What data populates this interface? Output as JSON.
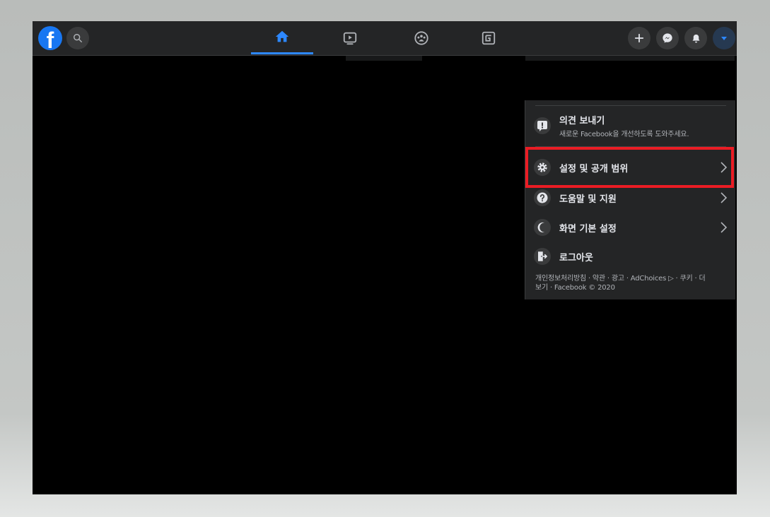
{
  "header": {
    "logo": "f",
    "search_icon": "search-icon",
    "nav_tabs": [
      {
        "icon": "home-icon",
        "active": true
      },
      {
        "icon": "watch-icon",
        "active": false
      },
      {
        "icon": "groups-icon",
        "active": false
      },
      {
        "icon": "gaming-icon",
        "active": false
      }
    ],
    "right_buttons": [
      "plus-icon",
      "messenger-icon",
      "bell-icon",
      "caret-down-icon"
    ],
    "colors": {
      "accent": "#2d88ff",
      "brand": "#1877f2",
      "bar": "#242526"
    }
  },
  "menu": {
    "feedback": {
      "label": "의견 보내기",
      "subtitle": "새로운 Facebook을 개선하도록 도와주세요.",
      "icon": "exclamation-icon"
    },
    "items": [
      {
        "label": "설정 및 공개 범위",
        "icon": "gear-icon",
        "has_arrow": true,
        "highlighted": true
      },
      {
        "label": "도움말 및 지원",
        "icon": "question-icon",
        "has_arrow": true
      },
      {
        "label": "화면 기본 설정",
        "icon": "moon-icon",
        "has_arrow": true
      },
      {
        "label": "로그아웃",
        "icon": "logout-icon",
        "has_arrow": false
      }
    ],
    "footer": {
      "line1": "개인정보처리방침 · 약관 · 광고 · AdChoices ▷ · 쿠키 · 더",
      "line2": "보기 · Facebook © 2020"
    },
    "highlight_color": "#ea1c24"
  }
}
